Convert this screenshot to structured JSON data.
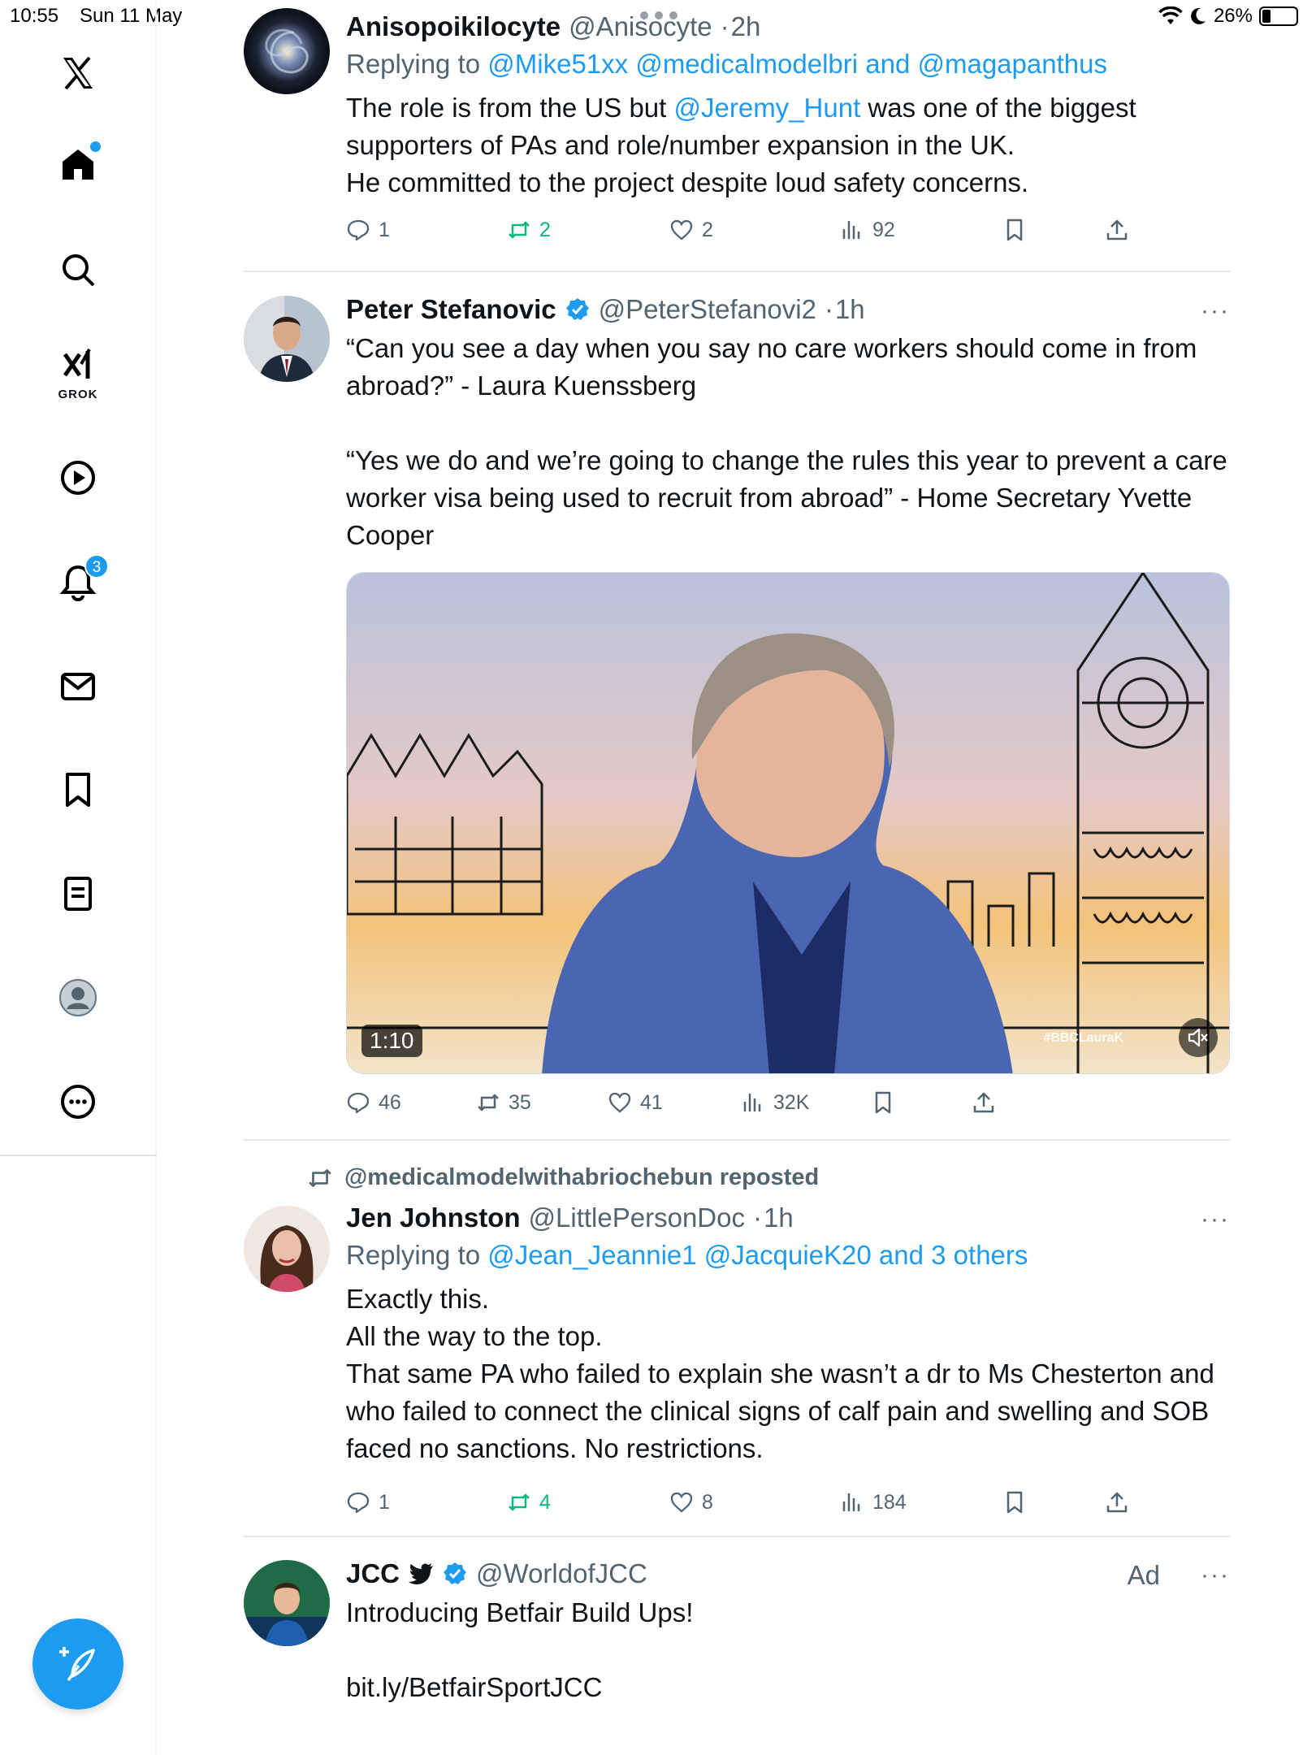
{
  "status_bar": {
    "time": "10:55",
    "date": "Sun 11 May",
    "battery": "26%",
    "battery_level": 0.26
  },
  "sidebar": {
    "icons": [
      "x-logo-icon",
      "home-icon",
      "search-icon",
      "grok-icon",
      "video-icon",
      "notifications-icon",
      "messages-icon",
      "bookmarks-icon",
      "lists-icon",
      "profile-icon",
      "more-icon"
    ],
    "grok_label": "GROK",
    "notifications_count": "3",
    "compose_icon": "compose-icon"
  },
  "tweets": [
    {
      "name": "Anisopoikilocyte",
      "handle": "@Anisocyte",
      "time": "2h",
      "replying_prefix": "Replying to ",
      "replying_to": "@Mike51xx @medicalmodelbri and @magapanthus",
      "text_before": "The role is from the US but ",
      "mention": "@Jeremy_Hunt",
      "text_after": " was one of the biggest\nsupporters of PAs and role/number expansion in the UK.\nHe committed to the project despite loud safety concerns.",
      "replies": "1",
      "reposts": "2",
      "likes": "2",
      "views": "92"
    },
    {
      "name": "Peter Stefanovic",
      "handle": "@PeterStefanovi2",
      "time": "1h",
      "more": "···",
      "text": "“Can you see a day when you say no care workers should come in from abroad?” - Laura Kuenssberg\n\n“Yes we do and we’re going to change the rules this year to prevent a care worker visa being used to recruit from abroad” - Home Secretary Yvette Cooper",
      "video_duration": "1:10",
      "video_watermark": "#BBCLauraK",
      "replies": "46",
      "reposts": "35",
      "likes": "41",
      "views": "32K"
    },
    {
      "repost_by": "@medicalmodelwithabriochebun reposted",
      "name": "Jen Johnston",
      "handle": "@LittlePersonDoc",
      "time": "1h",
      "more": "···",
      "replying_prefix": "Replying to ",
      "replying_to": "@Jean_Jeannie1 @JacquieK20 and 3 others",
      "text": "Exactly this.\nAll the way to the top.\nThat same PA who failed to explain she wasn’t a dr to Ms Chesterton and who failed to connect the clinical signs of calf pain and swelling and SOB faced no sanctions. No restrictions.",
      "replies": "1",
      "reposts": "4",
      "likes": "8",
      "views": "184"
    },
    {
      "name": "JCC",
      "handle": "@WorldofJCC",
      "ad_label": "Ad",
      "more": "···",
      "text": "Introducing Betfair Build Ups!",
      "link": "bit.ly/BetfairSportJCC"
    }
  ],
  "colors": {
    "accent": "#1d9bf0",
    "repost_active": "#00ba7c",
    "muted": "#536471"
  }
}
